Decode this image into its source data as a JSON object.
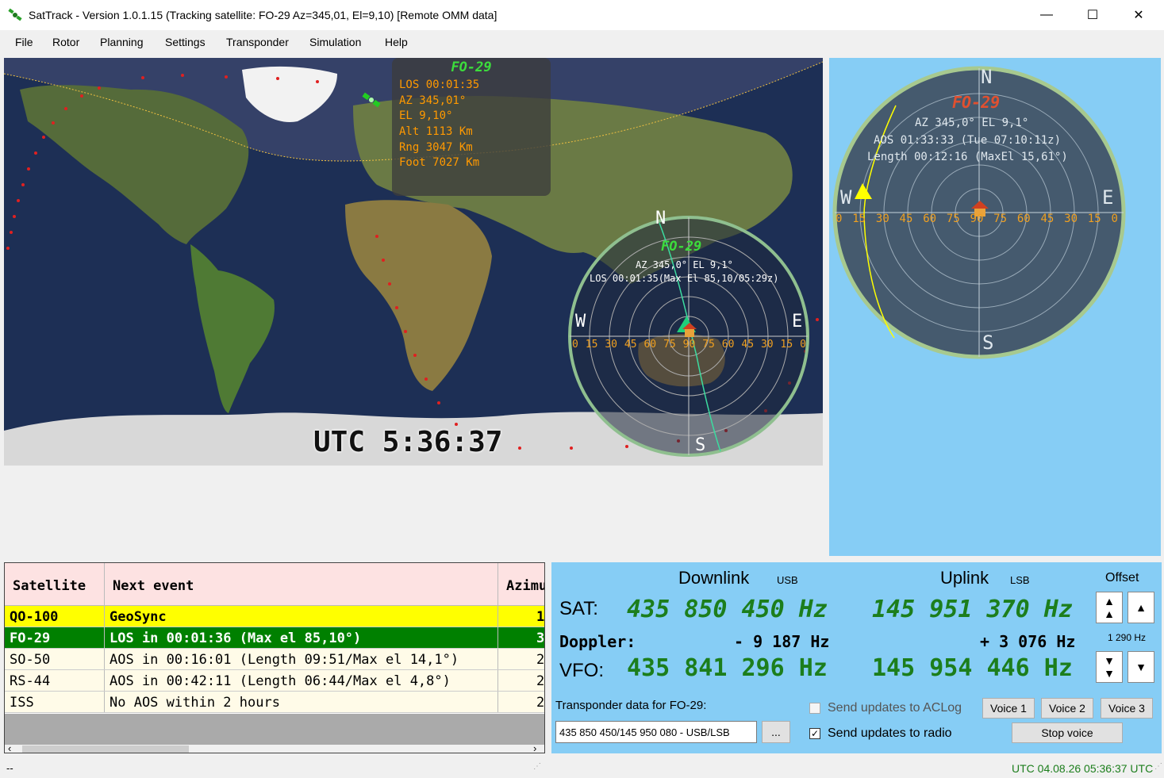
{
  "window": {
    "title": "SatTrack - Version 1.0.1.15 (Tracking satellite: FO-29 Az=345,01, El=9,10) [Remote OMM data]",
    "minimize": "—",
    "maximize": "☐",
    "close": "✕"
  },
  "menu": [
    "File",
    "Rotor",
    "Planning",
    "Settings",
    "Transponder",
    "Simulation",
    "Help"
  ],
  "map": {
    "info_title": "FO-29",
    "info_lines": [
      "LOS 00:01:35",
      "AZ  345,01°",
      "EL  9,10°",
      "Alt 1113 Km",
      "Rng 3047 Km",
      "Foot 7027 Km"
    ],
    "utc_clock": "UTC 5:36:37",
    "polar": {
      "title": "FO-29",
      "line1": "AZ 345,0° EL 9,1°",
      "line2": "LOS 00:01:35(Max El 85,10/05:29z)",
      "n": "N",
      "s": "S",
      "e": "E",
      "w": "W",
      "scale": [
        "0",
        "15",
        "30",
        "45",
        "60",
        "75",
        "90",
        "75",
        "60",
        "45",
        "30",
        "15",
        "0"
      ]
    }
  },
  "right_polar": {
    "title": "FO-29",
    "line1": "AZ 345,0° EL 9,1°",
    "line2": "AOS 01:33:33 (Tue 07:10:11z)",
    "line3": "Length 00:12:16 (MaxEl 15,61°)",
    "n": "N",
    "s": "S",
    "e": "E",
    "w": "W",
    "scale": [
      "0",
      "15",
      "30",
      "45",
      "60",
      "75",
      "90",
      "75",
      "60",
      "45",
      "30",
      "15",
      "0"
    ]
  },
  "table": {
    "headers": [
      "Satellite",
      "Next event",
      "Azimu"
    ],
    "rows": [
      {
        "sat": "QO-100",
        "event": "GeoSync",
        "az": "1",
        "bg": "#ffff00",
        "fg": "#000000",
        "bold": true
      },
      {
        "sat": "FO-29",
        "event": "LOS in 00:01:36 (Max el 85,10°)",
        "az": "3",
        "bg": "#008000",
        "fg": "#ffffff",
        "bold": true
      },
      {
        "sat": "SO-50",
        "event": "AOS in 00:16:01 (Length 09:51/Max el 14,1°)",
        "az": "2",
        "bg": "#fffbe8",
        "fg": "#000000",
        "bold": false
      },
      {
        "sat": "RS-44",
        "event": "AOS in 00:42:11 (Length 06:44/Max el 4,8°)",
        "az": "2",
        "bg": "#fffbe8",
        "fg": "#000000",
        "bold": false
      },
      {
        "sat": "ISS",
        "event": "No AOS within 2 hours",
        "az": "2",
        "bg": "#fffbe8",
        "fg": "#000000",
        "bold": false
      }
    ],
    "scroll_left": "‹",
    "scroll_right": "›"
  },
  "radio": {
    "downlink_title": "Downlink",
    "downlink_mode": "USB",
    "uplink_title": "Uplink",
    "uplink_mode": "LSB",
    "offset_label": "Offset",
    "offset_value": "1 290 Hz",
    "sat_label": "SAT:",
    "doppler_label": "Doppler:",
    "vfo_label": "VFO:",
    "sat_down": "435 850 450 Hz",
    "sat_up": "145 951 370 Hz",
    "doppler_down": "- 9 187 Hz",
    "doppler_up": "+ 3 076 Hz",
    "vfo_down": "435 841 296 Hz",
    "vfo_up": "145 954 446 Hz",
    "transponder_label": "Transponder data for FO-29:",
    "transponder_value": "435 850 450/145 950 080 - USB/LSB",
    "browse_button": "...",
    "send_aclog_label": "Send updates to ACLog",
    "send_aclog_checked": false,
    "send_radio_label": "Send updates to radio",
    "send_radio_checked": true,
    "voice1": "Voice 1",
    "voice2": "Voice 2",
    "voice3": "Voice 3",
    "stop_voice": "Stop voice"
  },
  "status": {
    "left": "--",
    "right": "UTC 04.08.26 05:36:37 UTC"
  }
}
